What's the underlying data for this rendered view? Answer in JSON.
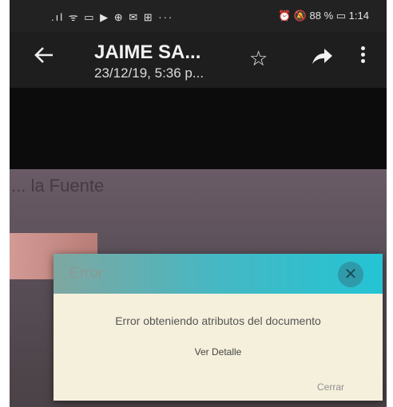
{
  "status_bar": {
    "left_icons": ".ıl ᯤ ▭ ▶ ⊕ ✉ ⊞ ···",
    "right_text": "⏰ 🔕 88 % ▭ 1:14"
  },
  "app_bar": {
    "title": "JAIME SA...",
    "subtitle": "23/12/19, 5:36 p..."
  },
  "photo": {
    "heading": "... la Fuente"
  },
  "dialog": {
    "title": "Error",
    "close_glyph": "✕",
    "message": "Error obteniendo atributos del documento",
    "detail_link": "Ver Detalle",
    "close_button": "Cerrar"
  },
  "colors": {
    "dialog_header": "#24c4d4",
    "dialog_body": "#f5f0dc"
  },
  "icons": [
    "back-arrow-icon",
    "star-icon",
    "share-icon",
    "more-vert-icon",
    "close-icon"
  ]
}
